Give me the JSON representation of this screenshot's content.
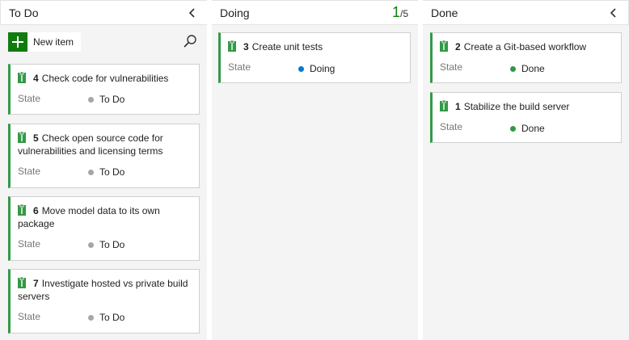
{
  "columns": {
    "todo": {
      "title": "To Do",
      "new_item_label": "New item",
      "cards": [
        {
          "id": "4",
          "title": "Check code for vulnerabilities",
          "state_label": "State",
          "state": "To Do"
        },
        {
          "id": "5",
          "title": "Check open source code for vulnerabilities and licensing terms",
          "state_label": "State",
          "state": "To Do"
        },
        {
          "id": "6",
          "title": "Move model data to its own package",
          "state_label": "State",
          "state": "To Do"
        },
        {
          "id": "7",
          "title": "Investigate hosted vs private build servers",
          "state_label": "State",
          "state": "To Do"
        }
      ]
    },
    "doing": {
      "title": "Doing",
      "wip_count": "1",
      "wip_limit": "/5",
      "cards": [
        {
          "id": "3",
          "title": "Create unit tests",
          "state_label": "State",
          "state": "Doing"
        }
      ]
    },
    "done": {
      "title": "Done",
      "cards": [
        {
          "id": "2",
          "title": "Create a Git-based workflow",
          "state_label": "State",
          "state": "Done"
        },
        {
          "id": "1",
          "title": "Stabilize the build server",
          "state_label": "State",
          "state": "Done"
        }
      ]
    }
  },
  "colors": {
    "card_accent": "#339947",
    "todo_dot": "#a6a6a6",
    "doing_dot": "#007acc",
    "done_dot": "#339947",
    "new_item_green": "#107c10",
    "wip_green": "#107c10"
  },
  "icons": {
    "card_type": "clipboard-icon",
    "collapse": "chevron-left-icon",
    "add": "plus-icon",
    "search": "search-icon"
  }
}
